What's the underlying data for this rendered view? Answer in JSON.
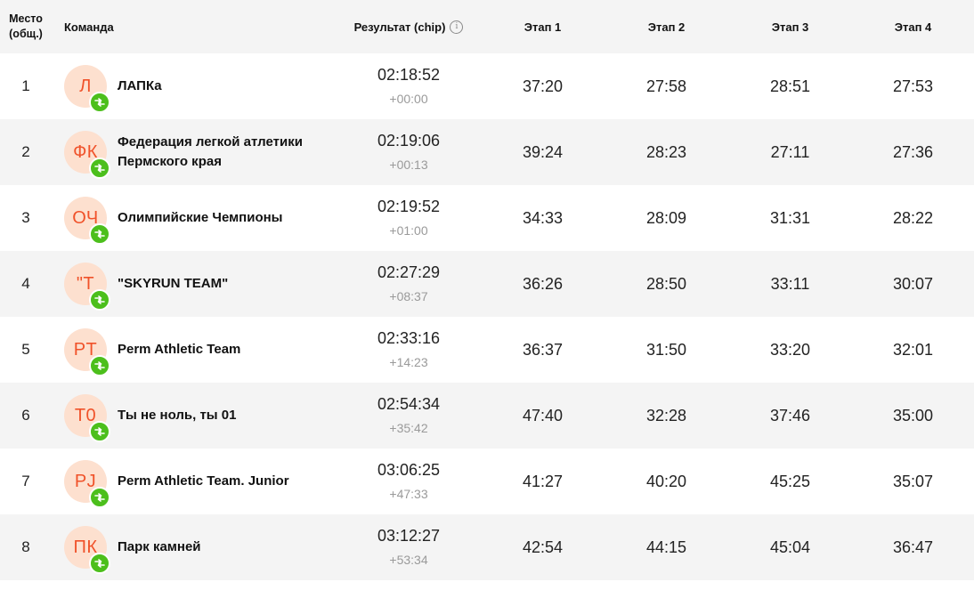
{
  "header": {
    "place_line1": "Место",
    "place_line2": "(общ.)",
    "team": "Команда",
    "result": "Результат (chip)",
    "info_icon": "info-icon",
    "stage1": "Этап 1",
    "stage2": "Этап 2",
    "stage3": "Этап 3",
    "stage4": "Этап 4"
  },
  "colors": {
    "avatar_bg": "#fde0cf",
    "avatar_text": "#f0522a",
    "relay_badge": "#4cbf1c",
    "stripe": "#f4f4f4"
  },
  "rows": [
    {
      "place": "1",
      "initials": "Л",
      "team": "ЛАПКа",
      "team2": "",
      "result": "02:18:52",
      "gap": "+00:00",
      "stages": [
        "37:20",
        "27:58",
        "28:51",
        "27:53"
      ]
    },
    {
      "place": "2",
      "initials": "ФК",
      "team": "Федерация легкой атлетики",
      "team2": "Пермского края",
      "result": "02:19:06",
      "gap": "+00:13",
      "stages": [
        "39:24",
        "28:23",
        "27:11",
        "27:36"
      ]
    },
    {
      "place": "3",
      "initials": "ОЧ",
      "team": "Олимпийские Чемпионы",
      "team2": "",
      "result": "02:19:52",
      "gap": "+01:00",
      "stages": [
        "34:33",
        "28:09",
        "31:31",
        "28:22"
      ]
    },
    {
      "place": "4",
      "initials": "\"T",
      "team": "\"SKYRUN TEAM\"",
      "team2": "",
      "result": "02:27:29",
      "gap": "+08:37",
      "stages": [
        "36:26",
        "28:50",
        "33:11",
        "30:07"
      ]
    },
    {
      "place": "5",
      "initials": "PT",
      "team": "Perm Athletic Team",
      "team2": "",
      "result": "02:33:16",
      "gap": "+14:23",
      "stages": [
        "36:37",
        "31:50",
        "33:20",
        "32:01"
      ]
    },
    {
      "place": "6",
      "initials": "Т0",
      "team": "Ты не ноль, ты 01",
      "team2": "",
      "result": "02:54:34",
      "gap": "+35:42",
      "stages": [
        "47:40",
        "32:28",
        "37:46",
        "35:00"
      ]
    },
    {
      "place": "7",
      "initials": "PJ",
      "team": "Perm Athletic Team. Junior",
      "team2": "",
      "result": "03:06:25",
      "gap": "+47:33",
      "stages": [
        "41:27",
        "40:20",
        "45:25",
        "35:07"
      ]
    },
    {
      "place": "8",
      "initials": "ПК",
      "team": "Парк камней",
      "team2": "",
      "result": "03:12:27",
      "gap": "+53:34",
      "stages": [
        "42:54",
        "44:15",
        "45:04",
        "36:47"
      ]
    }
  ]
}
